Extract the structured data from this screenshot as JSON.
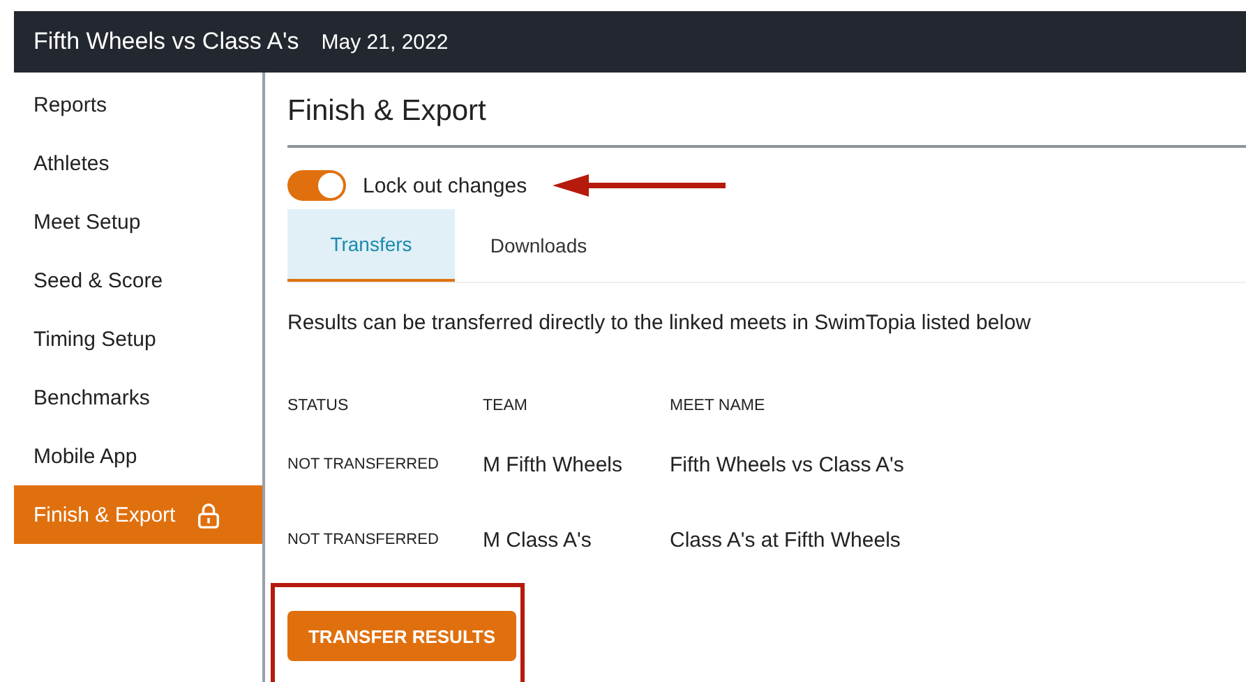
{
  "header": {
    "title": "Fifth Wheels vs Class A's",
    "date": "May 21, 2022"
  },
  "sidebar": {
    "items": [
      {
        "label": "Reports",
        "selected": false,
        "locked": false
      },
      {
        "label": "Athletes",
        "selected": false,
        "locked": false
      },
      {
        "label": "Meet Setup",
        "selected": false,
        "locked": false
      },
      {
        "label": "Seed & Score",
        "selected": false,
        "locked": false
      },
      {
        "label": "Timing Setup",
        "selected": false,
        "locked": false
      },
      {
        "label": "Benchmarks",
        "selected": false,
        "locked": false
      },
      {
        "label": "Mobile App",
        "selected": false,
        "locked": false
      },
      {
        "label": "Finish & Export",
        "selected": true,
        "locked": true
      }
    ]
  },
  "page_title": "Finish & Export",
  "lock_toggle": {
    "label": "Lock out changes",
    "on": true
  },
  "tabs": [
    {
      "label": "Transfers",
      "selected": true
    },
    {
      "label": "Downloads",
      "selected": false
    }
  ],
  "description": "Results can be transferred directly to the linked meets in SwimTopia listed below",
  "table": {
    "columns": [
      "STATUS",
      "TEAM",
      "MEET NAME"
    ],
    "rows": [
      [
        "NOT TRANSFERRED",
        "M Fifth Wheels",
        "Fifth Wheels vs Class A's"
      ],
      [
        "NOT TRANSFERRED",
        "M Class A's",
        "Class A's at Fifth Wheels"
      ]
    ]
  },
  "button": "TRANSFER RESULTS"
}
